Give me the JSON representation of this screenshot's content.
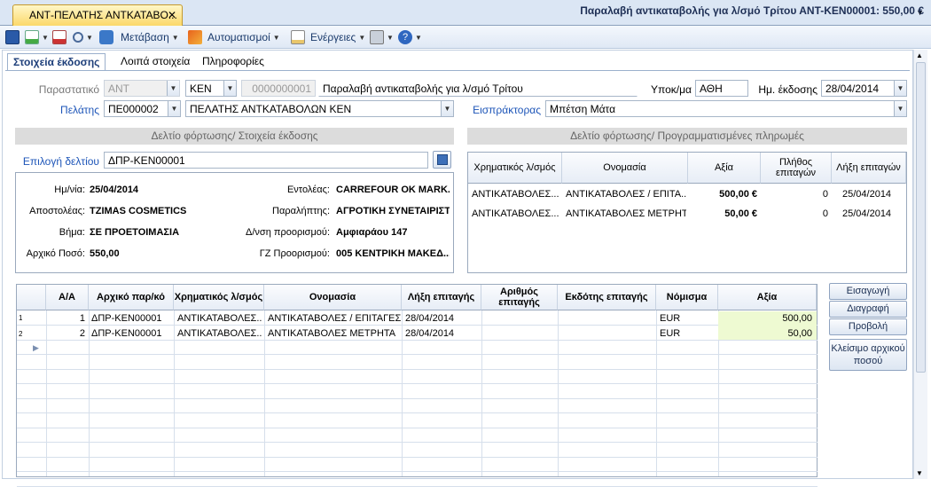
{
  "tabs": {
    "doc_tab": "ΑΝΤ-ΠΕΛΑΤΗΣ ΑΝΤΚΑΤΑΒΟ...",
    "close": "✕"
  },
  "toolbar": {
    "metavasi": "Μετάβαση",
    "automatismoi": "Αυτοματισμοί",
    "energeies": "Ενέργειες",
    "title": "Παραλαβή αντικαταβολής για λ/σμό Τρίτου ΑΝΤ-ΚΕΝ00001: 550,00 €"
  },
  "subtabs": [
    "Στοιχεία έκδοσης",
    "Λοιπά στοιχεία",
    "Πληροφορίες"
  ],
  "form": {
    "parastatiko_label": "Παραστατικό",
    "parastatiko": "ΑΝΤ",
    "seira": "ΚΕΝ",
    "arithmos": "0000000001",
    "perigrafi": "Παραλαβή αντικαταβολής για λ/σμό Τρίτου",
    "ypok_label": "Υποκ/μα",
    "ypok": "ΑΘΗ",
    "hm_label": "Ημ. έκδοσης",
    "hm": "28/04/2014",
    "pelatis_label": "Πελάτης",
    "pelatis_code": "ΠΕ000002",
    "pelatis_name": "ΠΕΛΑΤΗΣ ΑΝΤΚΑΤΑΒΟΛΩΝ ΚΕΝ",
    "eispraktoras_label": "Εισπράκτορας",
    "eispraktoras": "Μπέτση Μάτα"
  },
  "sections": {
    "left": "Δελτίο φόρτωσης/ Στοιχεία έκδοσης",
    "right": "Δελτίο φόρτωσης/ Προγραμματισμένες πληρωμές"
  },
  "deltio": {
    "label": "Επιλογή δελτίου",
    "value": "ΔΠΡ-ΚΕΝ00001"
  },
  "info": {
    "date_l": "Ημ/νία:",
    "date": "25/04/2014",
    "apost_l": "Αποστολέας:",
    "apost": "TZIMAS COSMETICS",
    "vima_l": "Βήμα:",
    "vima": "ΣΕ ΠΡΟΕΤΟΙΜΑΣΙΑ",
    "poso_l": "Αρχικό Ποσό:",
    "poso": "550,00",
    "entol_l": "Εντολέας:",
    "entol": "CARREFOUR OK MARK...",
    "paral_l": "Παραλήπτης:",
    "paral": "ΑΓΡΟΤΙΚΗ ΣΥΝΕΤΑΙΡΙΣΤΙ...",
    "dieuth_l": "Δ/νση προορισμού:",
    "dieuth": "Αμφιαράου 147",
    "gz_l": "ΓΖ Προορισμού:",
    "gz": "005 ΚΕΝΤΡΙΚΗ ΜΑΚΕΔ..."
  },
  "payments": {
    "headers": [
      "Χρηματικός λ/σμός",
      "Ονομασία",
      "Αξία",
      "Πλήθος επιταγών",
      "Λήξη επιταγών"
    ],
    "rows": [
      [
        "ΑΝΤΙΚΑΤΑΒΟΛΕΣ...",
        "ΑΝΤΙΚΑΤΑΒΟΛΕΣ / ΕΠΙΤΑ...",
        "500,00 €",
        "0",
        "25/04/2014"
      ],
      [
        "ΑΝΤΙΚΑΤΑΒΟΛΕΣ...",
        "ΑΝΤΙΚΑΤΑΒΟΛΕΣ ΜΕΤΡΗΤΑ",
        "50,00 €",
        "0",
        "25/04/2014"
      ]
    ]
  },
  "grid": {
    "headers": [
      "Α/Α",
      "Αρχικό παρ/κό",
      "Χρηματικός λ/σμός",
      "Ονομασία",
      "Λήξη επιταγής",
      "Αριθμός επιταγής",
      "Εκδότης επιταγής",
      "Νόμισμα",
      "Αξία"
    ],
    "rows": [
      {
        "n": "1",
        "aa": "1",
        "arx": "ΔΠΡ-ΚΕΝ00001",
        "xr": "ΑΝΤΙΚΑΤΑΒΟΛΕΣ...",
        "on": "ΑΝΤΙΚΑΤΑΒΟΛΕΣ / ΕΠΙΤΑΓΕΣ",
        "lixi": "28/04/2014",
        "arith": "",
        "ekd": "",
        "nom": "EUR",
        "axia": "500,00"
      },
      {
        "n": "2",
        "aa": "2",
        "arx": "ΔΠΡ-ΚΕΝ00001",
        "xr": "ΑΝΤΙΚΑΤΑΒΟΛΕΣ...",
        "on": "ΑΝΤΙΚΑΤΑΒΟΛΕΣ ΜΕΤΡΗΤΑ",
        "lixi": "28/04/2014",
        "arith": "",
        "ekd": "",
        "nom": "EUR",
        "axia": "50,00"
      }
    ]
  },
  "buttons": {
    "eisagogi": "Εισαγωγή",
    "diagrafi": "Διαγραφή",
    "provoli": "Προβολή",
    "kleisimo": "Κλείσιμο αρχικού ποσού"
  },
  "colors": {
    "accent": "#1d55b8",
    "highlight": "#eefad2"
  }
}
